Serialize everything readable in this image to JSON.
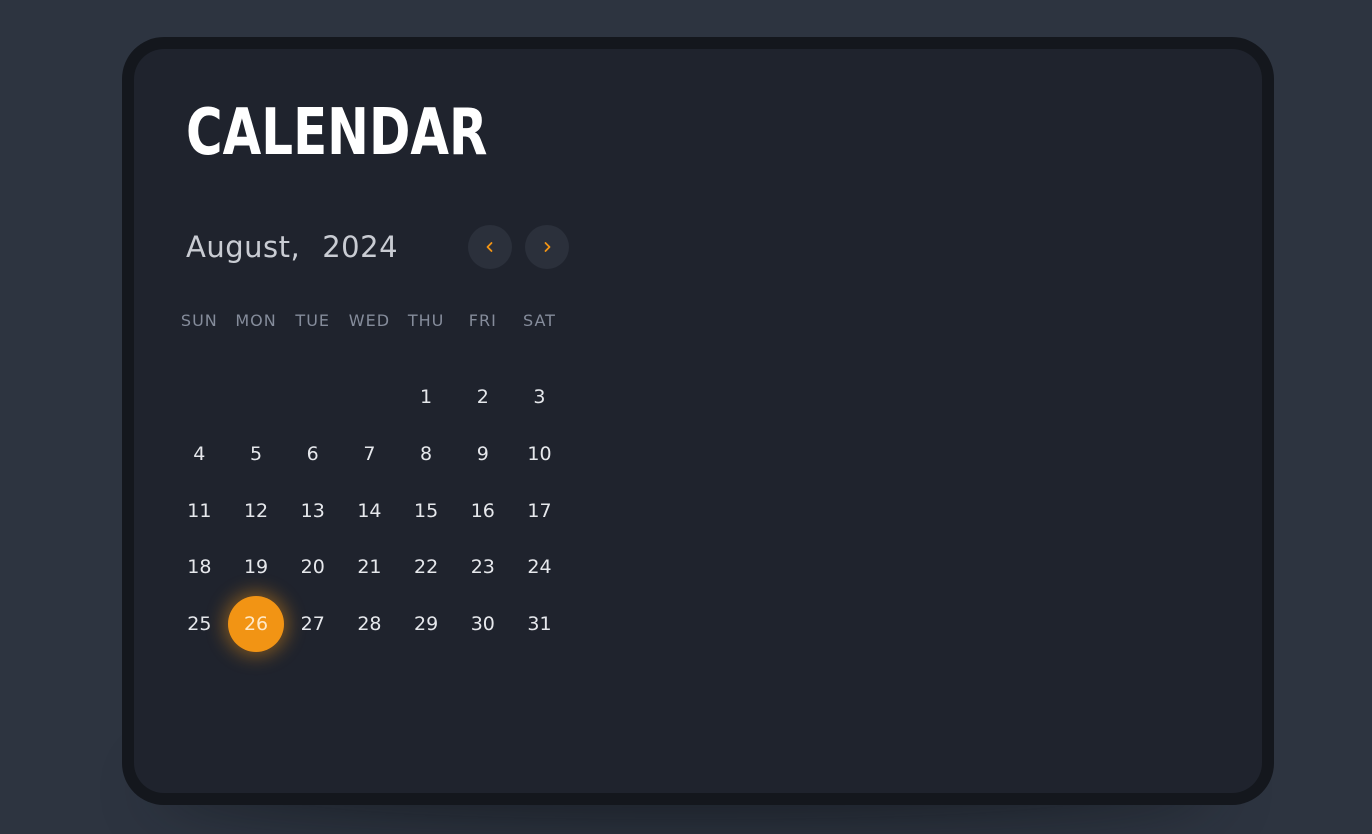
{
  "title": "CALENDAR",
  "month": "August,",
  "year": "2024",
  "nav": {
    "prev_icon": "chevron-left-icon",
    "next_icon": "chevron-right-icon"
  },
  "weekdays": [
    "SUN",
    "MON",
    "TUE",
    "WED",
    "THU",
    "FRI",
    "SAT"
  ],
  "leading_empty_days": 4,
  "days": [
    "1",
    "2",
    "3",
    "4",
    "5",
    "6",
    "7",
    "8",
    "9",
    "10",
    "11",
    "12",
    "13",
    "14",
    "15",
    "16",
    "17",
    "18",
    "19",
    "20",
    "21",
    "22",
    "23",
    "24",
    "25",
    "26",
    "27",
    "28",
    "29",
    "30",
    "31"
  ],
  "selected_day": "26",
  "colors": {
    "accent": "#f29414",
    "background": "#2d3440",
    "card": "#1f232d",
    "card_border": "#14171d"
  }
}
